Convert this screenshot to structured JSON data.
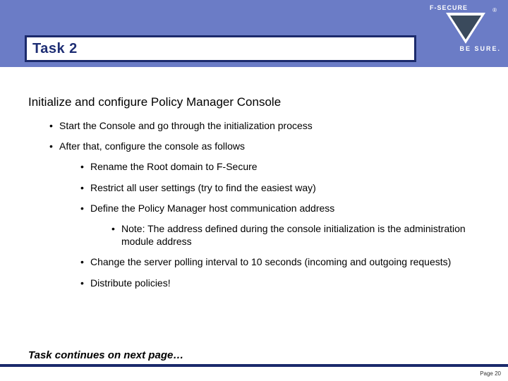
{
  "header": {
    "title": "Task 2",
    "logo": {
      "brand": "F-SECURE",
      "tagline": "BE SURE.",
      "reg": "®"
    }
  },
  "content": {
    "heading": "Initialize and configure Policy Manager Console",
    "b1": "Start the Console and go through the initialization process",
    "b2": "After that, configure the console as follows",
    "b2_1": "Rename the Root domain to F-Secure",
    "b2_2": "Restrict all user settings (try to find the easiest way)",
    "b2_3": "Define the Policy Manager host communication address",
    "b2_3_1": "Note: The address defined during the console initialization is the administration module address",
    "b2_4": "Change the server polling interval to 10 seconds (incoming and outgoing requests)",
    "b2_5": "Distribute policies!"
  },
  "continues": "Task continues on next page…",
  "footer": {
    "page": "Page 20"
  }
}
